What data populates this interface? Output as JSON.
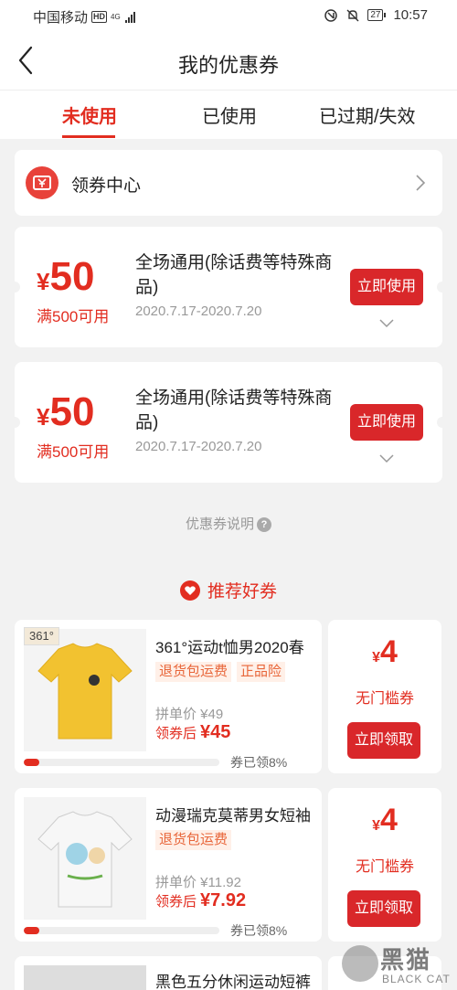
{
  "status_bar": {
    "carrier": "中国移动",
    "hd": "HD",
    "network": "4G",
    "battery": "27",
    "time": "10:57"
  },
  "header": {
    "title": "我的优惠券"
  },
  "tabs": [
    {
      "label": "未使用",
      "active": true
    },
    {
      "label": "已使用",
      "active": false
    },
    {
      "label": "已过期/失效",
      "active": false
    }
  ],
  "coupon_center": {
    "label": "领券中心"
  },
  "coupons": [
    {
      "currency": "¥",
      "amount": "50",
      "condition": "满500可用",
      "title": "全场通用(除话费等特殊商品)",
      "date": "2020.7.17-2020.7.20",
      "button": "立即使用"
    },
    {
      "currency": "¥",
      "amount": "50",
      "condition": "满500可用",
      "title": "全场通用(除话费等特殊商品)",
      "date": "2020.7.17-2020.7.20",
      "button": "立即使用"
    }
  ],
  "description": {
    "label": "优惠券说明",
    "icon": "?"
  },
  "recommend": {
    "title": "推荐好券"
  },
  "products": [
    {
      "image_tag": "361°",
      "title": "361°运动t恤男2020春",
      "badges": [
        "退货包运费",
        "正品险"
      ],
      "group_price": "拼单价 ¥49",
      "after_label": "领券后",
      "after_price": "¥45",
      "progress": 0.08,
      "progress_text": "券已领8%",
      "voucher": {
        "currency": "¥",
        "amount": "4",
        "label": "无门槛券",
        "button": "立即领取"
      },
      "colors": {
        "shirt": "#f2c230"
      }
    },
    {
      "image_tag": "",
      "title": "动漫瑞克莫蒂男女短袖",
      "badges": [
        "退货包运费"
      ],
      "group_price": "拼单价 ¥11.92",
      "after_label": "领券后",
      "after_price": "¥7.92",
      "progress": 0.08,
      "progress_text": "券已领8%",
      "voucher": {
        "currency": "¥",
        "amount": "4",
        "label": "无门槛券",
        "button": "立即领取"
      },
      "colors": {
        "shirt": "#f7f7f7"
      }
    }
  ],
  "product_3": {
    "title": "黑色五分休闲运动短裤"
  },
  "watermark": {
    "brand": "黑猫",
    "sub": "BLACK CAT"
  },
  "colors": {
    "accent": "#e22d20",
    "button": "#d9272a",
    "background": "#f2f2f2"
  }
}
